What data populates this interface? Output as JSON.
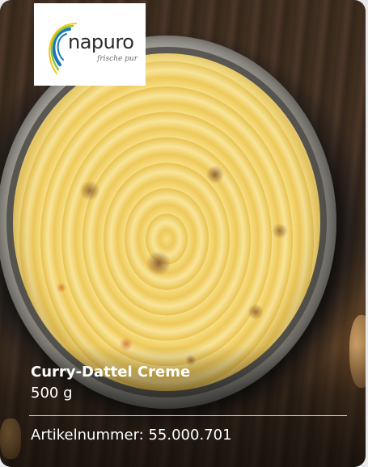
{
  "logo": {
    "brand": "napuro",
    "tagline": "frische pur",
    "colors": {
      "swirl_blue": "#1b75bc",
      "swirl_green": "#8dc63f",
      "swirl_yellow": "#f7c719",
      "text": "#2b2b2b"
    }
  },
  "product": {
    "name": "Curry-Dattel Creme",
    "weight": "500 g",
    "article_number": "Artikelnummer: 55.000.701"
  },
  "image": {
    "icon": "product-photo-icon"
  }
}
